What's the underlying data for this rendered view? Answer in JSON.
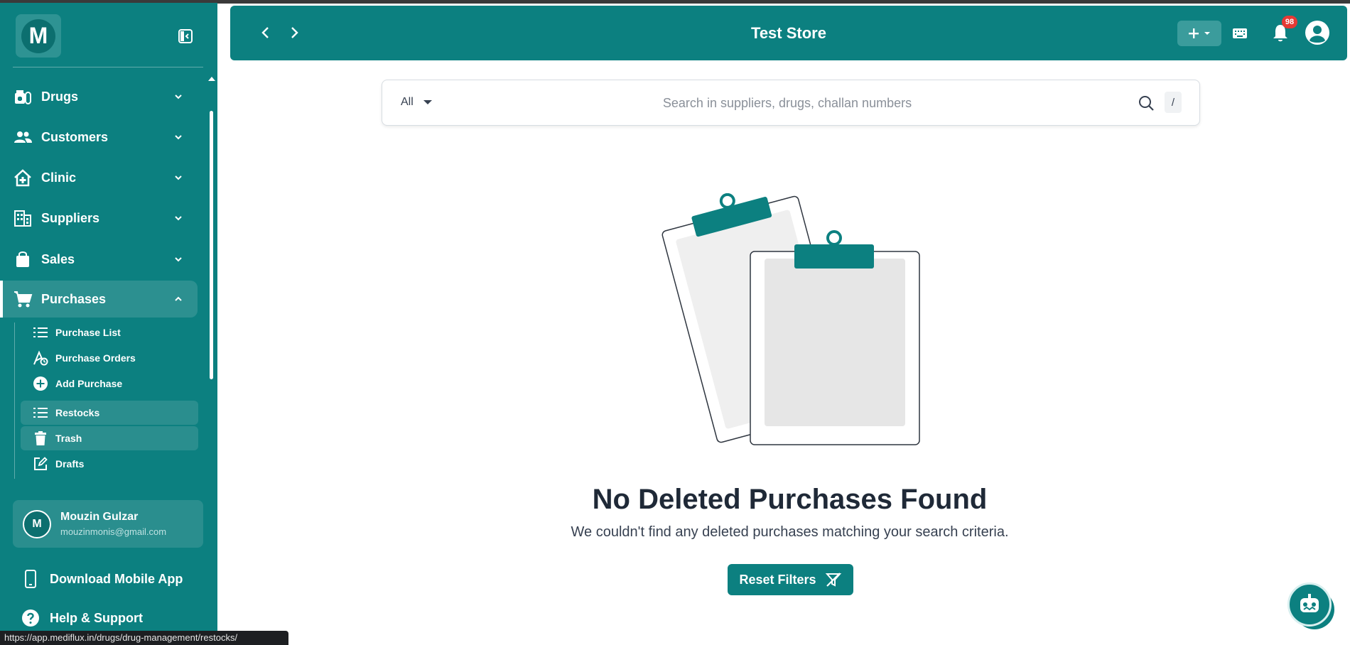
{
  "sidebar": {
    "logo_letter": "M",
    "nav": [
      {
        "label": "Drugs",
        "icon": "drugs-icon"
      },
      {
        "label": "Customers",
        "icon": "customers-icon"
      },
      {
        "label": "Clinic",
        "icon": "clinic-icon"
      },
      {
        "label": "Suppliers",
        "icon": "suppliers-icon"
      },
      {
        "label": "Sales",
        "icon": "sales-bag-icon"
      },
      {
        "label": "Purchases",
        "icon": "cart-icon",
        "expanded": true
      }
    ],
    "purchases_sub": [
      {
        "label": "Purchase List",
        "icon": "list-icon"
      },
      {
        "label": "Purchase Orders",
        "icon": "purchase-orders-icon"
      },
      {
        "label": "Add Purchase",
        "icon": "plus-circle-icon"
      },
      {
        "label": "Restocks",
        "icon": "list-icon"
      },
      {
        "label": "Trash",
        "icon": "trash-icon"
      },
      {
        "label": "Drafts",
        "icon": "edit-icon"
      }
    ],
    "user": {
      "initial": "M",
      "name": "Mouzin Gulzar",
      "email": "mouzinmonis@gmail.com"
    },
    "download_app": "Download Mobile App",
    "help": "Help & Support"
  },
  "header": {
    "store_name": "Test Store",
    "notification_count": "98"
  },
  "search": {
    "filter_value": "All",
    "placeholder": "Search in suppliers, drugs, challan numbers",
    "shortcut_key": "/"
  },
  "empty_state": {
    "title": "No Deleted Purchases Found",
    "message": "We couldn't find any deleted purchases matching your search criteria.",
    "reset_label": "Reset Filters"
  },
  "status_bar": {
    "url": "https://app.mediflux.in/drugs/drug-management/restocks/"
  },
  "colors": {
    "primary": "#0c8080",
    "badge": "#e53935"
  }
}
